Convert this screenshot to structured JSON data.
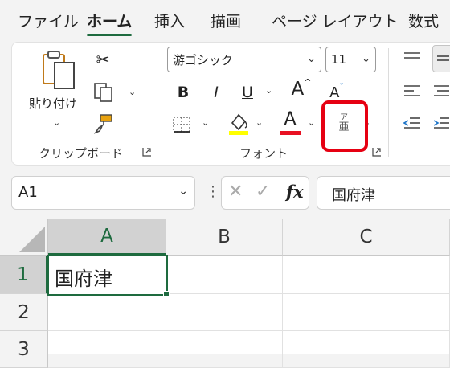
{
  "tabs": [
    "ファイル",
    "ホーム",
    "挿入",
    "描画",
    "ページ レイアウト",
    "数式"
  ],
  "active_tab": "ホーム",
  "clipboard": {
    "paste_label": "貼り付け",
    "group_label": "クリップボード"
  },
  "font": {
    "font_name": "游ゴシック",
    "font_size": "11",
    "bold_label": "B",
    "italic_label": "I",
    "underline_label": "U",
    "grow_label": "A",
    "shrink_label": "A",
    "font_color_label": "A",
    "phonetic_top": "ア",
    "phonetic_bottom": "亜",
    "group_label": "フォント"
  },
  "formula_bar": {
    "name_box": "A1",
    "fx_label": "fx",
    "content": "国府津"
  },
  "sheet": {
    "columns": [
      "A",
      "B",
      "C"
    ],
    "rows": [
      "1",
      "2",
      "3"
    ],
    "cell_a1": "国府津"
  },
  "colors": {
    "accent_green": "#1e6b3f",
    "highlight_yellow": "#ffff00",
    "font_red": "#e81123",
    "annotation_red": "#e60012"
  },
  "icons": [
    "clipboard-icon",
    "scissors-icon",
    "copy-icon",
    "format-painter-icon",
    "borders-icon",
    "fill-color-icon",
    "dialog-launcher-icon",
    "align-icon",
    "cancel-icon",
    "enter-icon"
  ]
}
